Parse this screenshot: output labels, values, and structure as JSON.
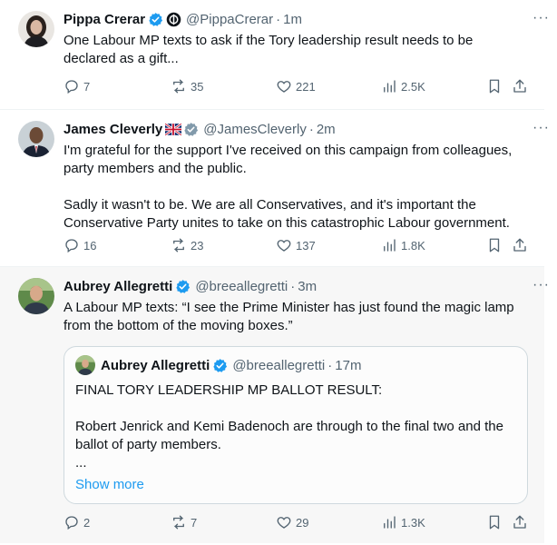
{
  "colors": {
    "verified": "#1d9bf0",
    "secondary": "#536471",
    "text": "#0f1419",
    "link": "#1d9bf0"
  },
  "tweets": [
    {
      "name": "Pippa Crerar",
      "handle": "@PippaCrerar",
      "time": "1m",
      "text": "One Labour MP texts to ask if the Tory leadership result needs to be declared as a gift...",
      "replies": "7",
      "reposts": "35",
      "likes": "221",
      "views": "2.5K"
    },
    {
      "name": "James Cleverly",
      "handle": "@JamesCleverly",
      "time": "2m",
      "text": "I'm grateful for the support I've received on this campaign from colleagues, party members and the public.\n\nSadly it wasn't to be. We are all Conservatives, and it's important the Conservative Party unites to take on this catastrophic Labour government.",
      "replies": "16",
      "reposts": "23",
      "likes": "137",
      "views": "1.8K"
    },
    {
      "name": "Aubrey Allegretti",
      "handle": "@breeallegretti",
      "time": "3m",
      "text": "A Labour MP texts: “I see the Prime Minister has just found the magic lamp from the bottom of the moving boxes.”",
      "replies": "2",
      "reposts": "7",
      "likes": "29",
      "views": "1.3K",
      "quote": {
        "name": "Aubrey Allegretti",
        "handle": "@breeallegretti",
        "time": "17m",
        "text": "FINAL TORY LEADERSHIP MP BALLOT RESULT:\n\nRobert Jenrick and Kemi Badenoch are through to the final two and the ballot of party members.\n...",
        "show_more": "Show more"
      }
    }
  ],
  "more_label": "···",
  "separator": "·"
}
